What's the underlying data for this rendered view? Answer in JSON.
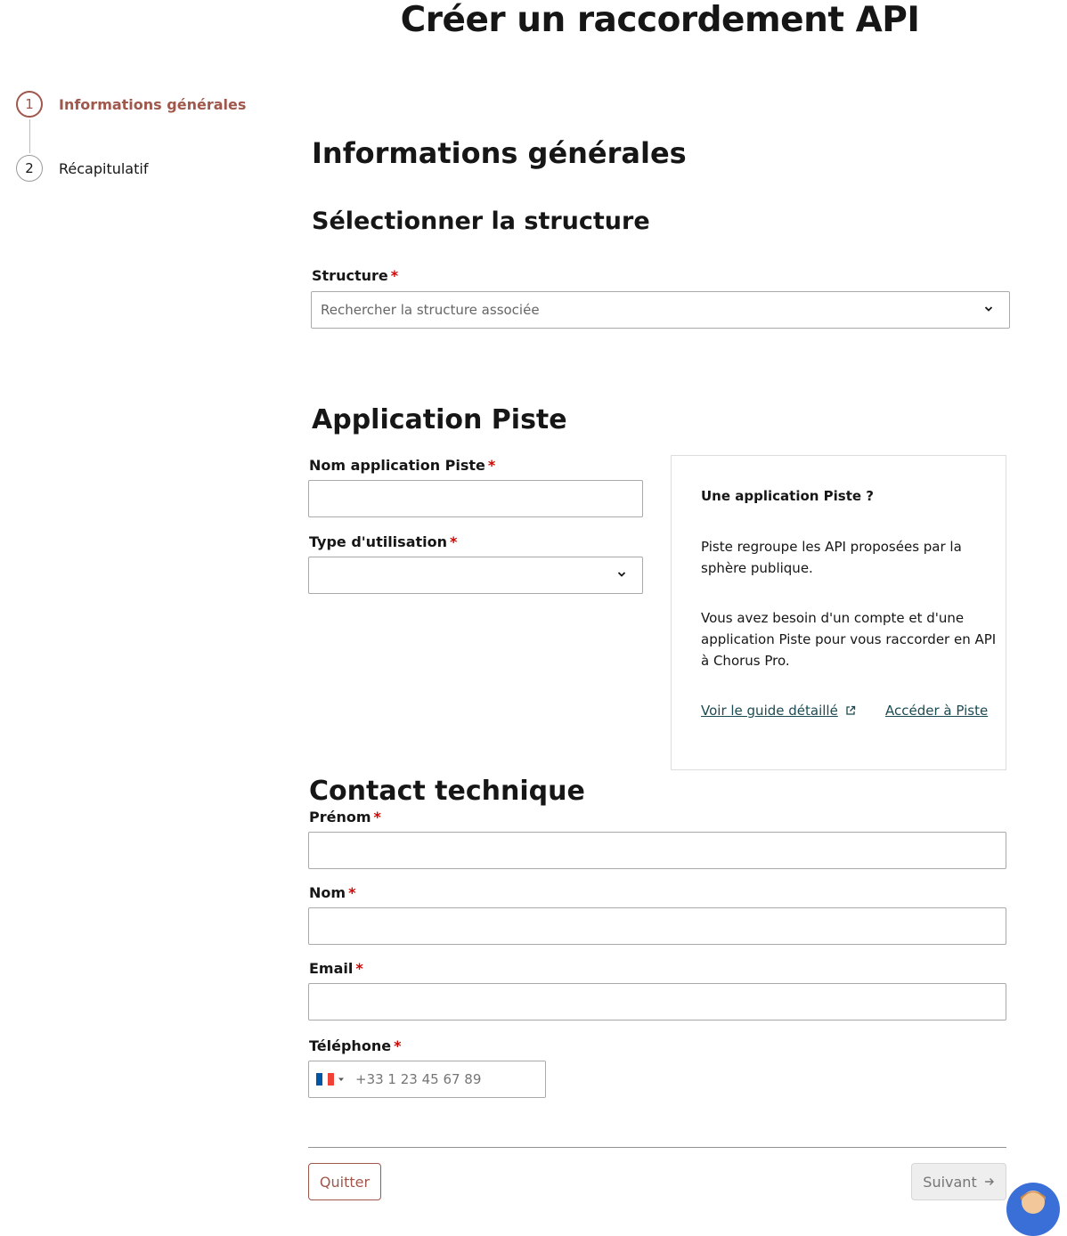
{
  "page": {
    "title": "Créer un raccordement API"
  },
  "stepper": {
    "steps": [
      {
        "number": "1",
        "label": "Informations générales",
        "active": true
      },
      {
        "number": "2",
        "label": "Récapitulatif",
        "active": false
      }
    ]
  },
  "main": {
    "heading": "Informations générales",
    "structure_section": {
      "title": "Sélectionner la structure",
      "structure_label": "Structure",
      "structure_placeholder": "Rechercher la structure associée"
    },
    "piste_section": {
      "title": "Application Piste",
      "app_name_label": "Nom application Piste",
      "app_name_value": "",
      "usage_type_label": "Type d'utilisation",
      "usage_type_value": ""
    },
    "info_box": {
      "title": "Une application Piste ?",
      "paragraph_1": "Piste regroupe les API proposées par la sphère publique.",
      "paragraph_2": "Vous avez besoin d'un compte et d'une application Piste pour vous raccorder en API à Chorus Pro.",
      "link_guide": "Voir le guide détaillé",
      "link_piste": "Accéder à Piste"
    },
    "contact_section": {
      "title": "Contact technique",
      "firstname_label": "Prénom",
      "firstname_value": "",
      "lastname_label": "Nom",
      "lastname_value": "",
      "email_label": "Email",
      "email_value": "",
      "phone_label": "Téléphone",
      "phone_placeholder": "+33 1 23 45 67 89",
      "phone_country_icon": "france-flag-icon"
    },
    "required_marker": "*"
  },
  "footer": {
    "quit_label": "Quitter",
    "next_label": "Suivant"
  },
  "colors": {
    "accent": "#a0574c",
    "required": "#ce0500",
    "link": "#1b4b52",
    "disabled_bg": "#eeeeee"
  }
}
